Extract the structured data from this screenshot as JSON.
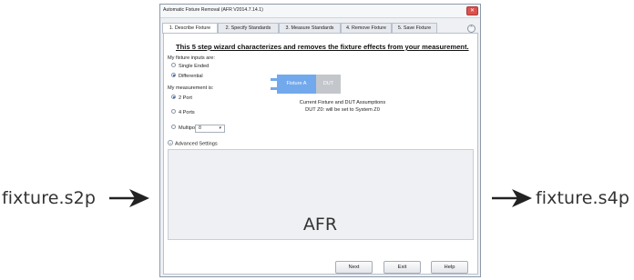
{
  "side_labels": {
    "input_file": "fixture.s2p",
    "output_file": "fixture.s4p"
  },
  "window": {
    "title": "Automatic Fixture Removal (AFR V2014.7.14.1)",
    "close_glyph": "✕"
  },
  "tabs": [
    {
      "label": "1. Describe Fixture",
      "active": true
    },
    {
      "label": "2. Specify Standards",
      "active": false
    },
    {
      "label": "3. Measure Standards",
      "active": false
    },
    {
      "label": "4. Remove Fixture",
      "active": false
    },
    {
      "label": "5. Save Fixture",
      "active": false
    }
  ],
  "content": {
    "headline": "This 5 step wizard characterizes and removes the fixture effects from your measurement.",
    "fixture_inputs_label": "My fixture inputs are:",
    "fixture_inputs": [
      {
        "label": "Single Ended",
        "selected": false
      },
      {
        "label": "Differential",
        "selected": true
      }
    ],
    "measurement_label": "My measurement is:",
    "measurement_options": [
      {
        "label": "2 Port",
        "selected": true
      },
      {
        "label": "4 Ports",
        "selected": false
      },
      {
        "label": "Multiport",
        "selected": false
      }
    ],
    "multiport_value": "8",
    "diagram": {
      "fixture_label": "Fixture A",
      "dut_label": "DUT",
      "fixture_color": "#72a9ec",
      "dut_color": "#c3c6cb"
    },
    "assumptions_line1": "Current Fixture and DUT Assumptions",
    "assumptions_line2": "DUT Z0: will be set to System Z0",
    "advanced_settings_label": "Advanced Settings",
    "overlay_label": "AFR"
  },
  "buttons": {
    "next": "Next",
    "exit": "Exit",
    "help": "Help"
  }
}
